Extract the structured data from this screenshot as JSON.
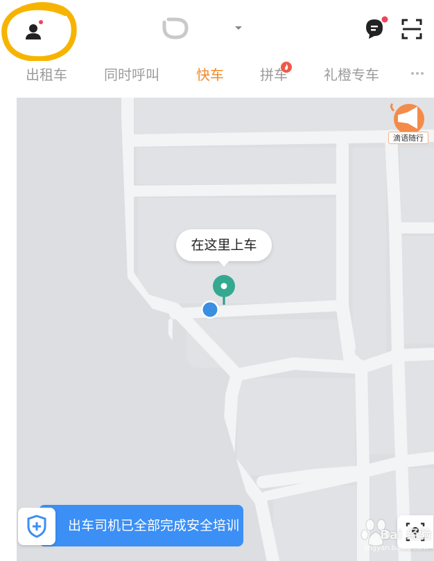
{
  "header": {
    "unread_dot_color": "#f0445a",
    "accent_color": "#f18a2c"
  },
  "tabs": [
    {
      "label": "出租车",
      "active": false
    },
    {
      "label": "同时呼叫",
      "active": false
    },
    {
      "label": "快车",
      "active": true
    },
    {
      "label": "拼车",
      "active": false,
      "badge": "fire-icon"
    },
    {
      "label": "礼橙专车",
      "active": false
    }
  ],
  "map": {
    "voice_badge_label": "滴语随行",
    "pickup_bubble": "在这里上车",
    "safety_text": "出车司机已全部完成安全培训"
  },
  "watermark": {
    "text": "Bai 经验",
    "sub": "jingyan.baidu.com"
  }
}
